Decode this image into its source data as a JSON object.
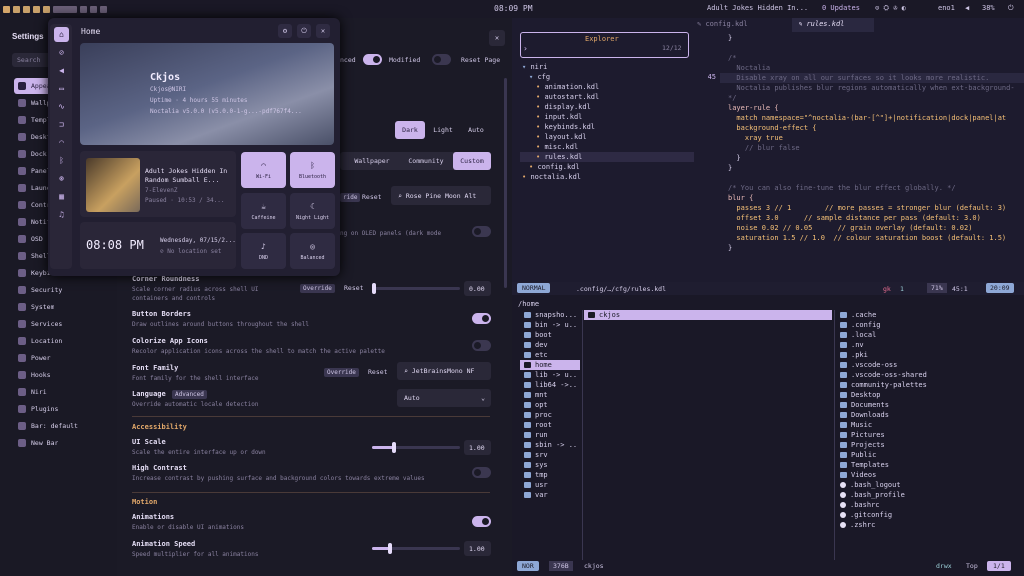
{
  "topbar": {
    "clock": "08:09 PM",
    "window_title": "Adult Jokes Hidden In...",
    "updates": "0 Updates",
    "network": "eno1",
    "battery": "38%"
  },
  "settings": {
    "title": "Settings",
    "search_placeholder": "Search",
    "close_label": "✕",
    "modified_label": "Modified",
    "reset_page_label": "Reset Page",
    "advanced_label": "nced",
    "sidebar": [
      {
        "label": "Appearance",
        "icon": "palette-icon"
      },
      {
        "label": "Wallpaper",
        "icon": "image-icon"
      },
      {
        "label": "Templates",
        "icon": "template-icon"
      },
      {
        "label": "Desktop",
        "icon": "desktop-icon"
      },
      {
        "label": "Dock",
        "icon": "dock-icon"
      },
      {
        "label": "Panels",
        "icon": "panel-icon"
      },
      {
        "label": "Launcher",
        "icon": "rocket-icon"
      },
      {
        "label": "Control Center",
        "icon": "control-icon"
      },
      {
        "label": "Notifications",
        "icon": "bell-icon"
      },
      {
        "label": "OSD",
        "icon": "osd-icon"
      },
      {
        "label": "Shell",
        "icon": "shell-icon"
      },
      {
        "label": "Keybinds",
        "icon": "keyboard-icon"
      },
      {
        "label": "Security",
        "icon": "shield-icon"
      },
      {
        "label": "System",
        "icon": "system-icon"
      },
      {
        "label": "Services",
        "icon": "services-icon"
      },
      {
        "label": "Location",
        "icon": "location-icon"
      },
      {
        "label": "Power",
        "icon": "power-icon"
      },
      {
        "label": "Hooks",
        "icon": "hooks-icon"
      },
      {
        "label": "Niri",
        "icon": "niri-icon"
      },
      {
        "label": "Plugins",
        "icon": "plugin-icon"
      },
      {
        "label": "Bar: default",
        "icon": "bar-icon"
      },
      {
        "label": "New Bar",
        "icon": "plus-icon"
      }
    ],
    "theme_mode": {
      "dark": "Dark",
      "light": "Light",
      "auto": "Auto"
    },
    "palette_tabs": {
      "wallpaper": "Wallpaper",
      "community": "Community",
      "custom": "Custom"
    },
    "override_label": "Override",
    "reset_label": "Reset",
    "palette_name": "Rose Pine Moon Alt",
    "oled_desc": "ng on OLED panels (dark mode",
    "rows": {
      "corner_title": "Corner Roundness",
      "corner_desc": "Scale corner radius across shell UI containers and controls",
      "corner_value": "0.00",
      "borders_title": "Button Borders",
      "borders_desc": "Draw outlines around buttons throughout the shell",
      "colorize_title": "Colorize App Icons",
      "colorize_desc": "Recolor application icons across the shell to match the active palette",
      "font_title": "Font Family",
      "font_desc": "Font family for the shell interface",
      "font_value": "JetBrainsMono NF",
      "lang_title": "Language",
      "lang_badge": "Advanced",
      "lang_desc": "Override automatic locale detection",
      "lang_value": "Auto",
      "accessibility": "Accessibility",
      "ui_scale_title": "UI Scale",
      "ui_scale_desc": "Scale the entire interface up or down",
      "ui_scale_value": "1.00",
      "contrast_title": "High Contrast",
      "contrast_desc": "Increase contrast by pushing surface and background colors towards extreme values",
      "motion": "Motion",
      "anim_title": "Animations",
      "anim_desc": "Enable or disable UI animations",
      "anim_speed_title": "Animation Speed",
      "anim_speed_desc": "Speed multiplier for all animations",
      "anim_speed_value": "1.00"
    }
  },
  "control_center": {
    "title": "Home",
    "user": "Ckjos",
    "user_host": "Ckjos@NIRI",
    "uptime": "Uptime · 4 hours 55 minutes",
    "version": "Noctalia v5.0.0 (v5.0.0-1-g...-pdf767f4...",
    "media_title": "Adult Jokes Hidden In Random Sumball E...",
    "media_artist": "7-ElevenZ",
    "media_status": "Paused · 10:53 / 34...",
    "time": "08:08 PM",
    "date": "Wednesday, 07/15/2...",
    "location": "No location set",
    "tiles": [
      {
        "label": "Wi-Fi",
        "icon": "wifi-icon",
        "on": true
      },
      {
        "label": "Bluetooth",
        "icon": "bluetooth-icon",
        "on": true
      },
      {
        "label": "Caffeine",
        "icon": "coffee-icon",
        "on": false
      },
      {
        "label": "Night Light",
        "icon": "moon-icon",
        "on": false
      },
      {
        "label": "DND",
        "icon": "bell-icon",
        "on": false
      },
      {
        "label": "Balanced",
        "icon": "gauge-icon",
        "on": false
      }
    ]
  },
  "editor": {
    "tab1": "config.kdl",
    "tab2": "rules.kdl",
    "explorer_title": "Explorer",
    "explorer_count": "12/12",
    "explorer_prompt": "›",
    "tree": [
      "niri",
      "cfg",
      "animation.kdl",
      "autostart.kdl",
      "display.kdl",
      "input.kdl",
      "keybinds.kdl",
      "layout.kdl",
      "misc.kdl",
      "rules.kdl",
      "config.kdl",
      "noctalia.kdl"
    ],
    "line_number": "45",
    "lines": [
      "}",
      "",
      "/*",
      "  Noctalia",
      "  Disable xray on all our surfaces so it looks more realistic.",
      "  Noctalia publishes blur regions automatically when ext-background-",
      "*/",
      "layer-rule {",
      "  match namespace=\"^noctalia-(bar-[^\"]+|notification|dock|panel|at",
      "  background-effect {",
      "    xray true",
      "    // blur false",
      "  }",
      "}",
      "",
      "/* You can also fine-tune the blur effect globally. */",
      "blur {",
      "  passes 3 // 1        // more passes = stronger blur (default: 3)",
      "  offset 3.0      // sample distance per pass (default: 3.0)",
      "  noise 0.02 // 0.05      // grain overlay (default: 0.02)",
      "  saturation 1.5 // 1.0  // colour saturation boost (default: 1.5)",
      "}"
    ],
    "status_mode": "NORMAL",
    "status_path": ".config/…/cfg/rules.kdl",
    "status_branch": "gk",
    "status_count": "1",
    "status_pct": "71%",
    "status_pos": "45:1",
    "status_time": "20:09"
  },
  "file_manager": {
    "path": "/home",
    "left": [
      "snapsho...",
      "bin -> u..",
      "boot",
      "dev",
      "etc",
      "home",
      "lib -> u..",
      "lib64 ->..",
      "mnt",
      "opt",
      "proc",
      "root",
      "run",
      "sbin -> ..",
      "srv",
      "sys",
      "tmp",
      "usr",
      "var"
    ],
    "middle": [
      "ckjos"
    ],
    "right": [
      ".cache",
      ".config",
      ".local",
      ".nv",
      ".pki",
      ".vscode-oss",
      ".vscode-oss-shared",
      "community-palettes",
      "Desktop",
      "Documents",
      "Downloads",
      "Music",
      "Pictures",
      "Projects",
      "Public",
      "Templates",
      "Videos",
      ".bash_logout",
      ".bash_profile",
      ".bashrc",
      ".gitconfig",
      ".zshrc"
    ],
    "status_mode": "NOR",
    "status_size": "376B",
    "status_user": "ckjos",
    "status_perm": "drwx",
    "status_top": "Top",
    "status_page": "1/1"
  }
}
